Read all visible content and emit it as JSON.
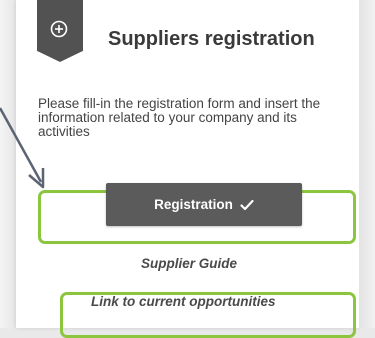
{
  "header": {
    "title": "Suppliers registration",
    "icon": "plus-circle-icon"
  },
  "intro": {
    "text": "Please fill-in the registration form and insert the information related to your company and its activities"
  },
  "registration_button": {
    "label": "Registration",
    "icon": "checkmark-icon"
  },
  "links": {
    "supplier_guide": "Supplier Guide",
    "current_opportunities": "Link to current opportunities"
  },
  "colors": {
    "highlight": "#8cc63f",
    "button_bg": "#5b5b5b",
    "ribbon_bg": "#525252",
    "title_text": "#3a3a3a"
  }
}
